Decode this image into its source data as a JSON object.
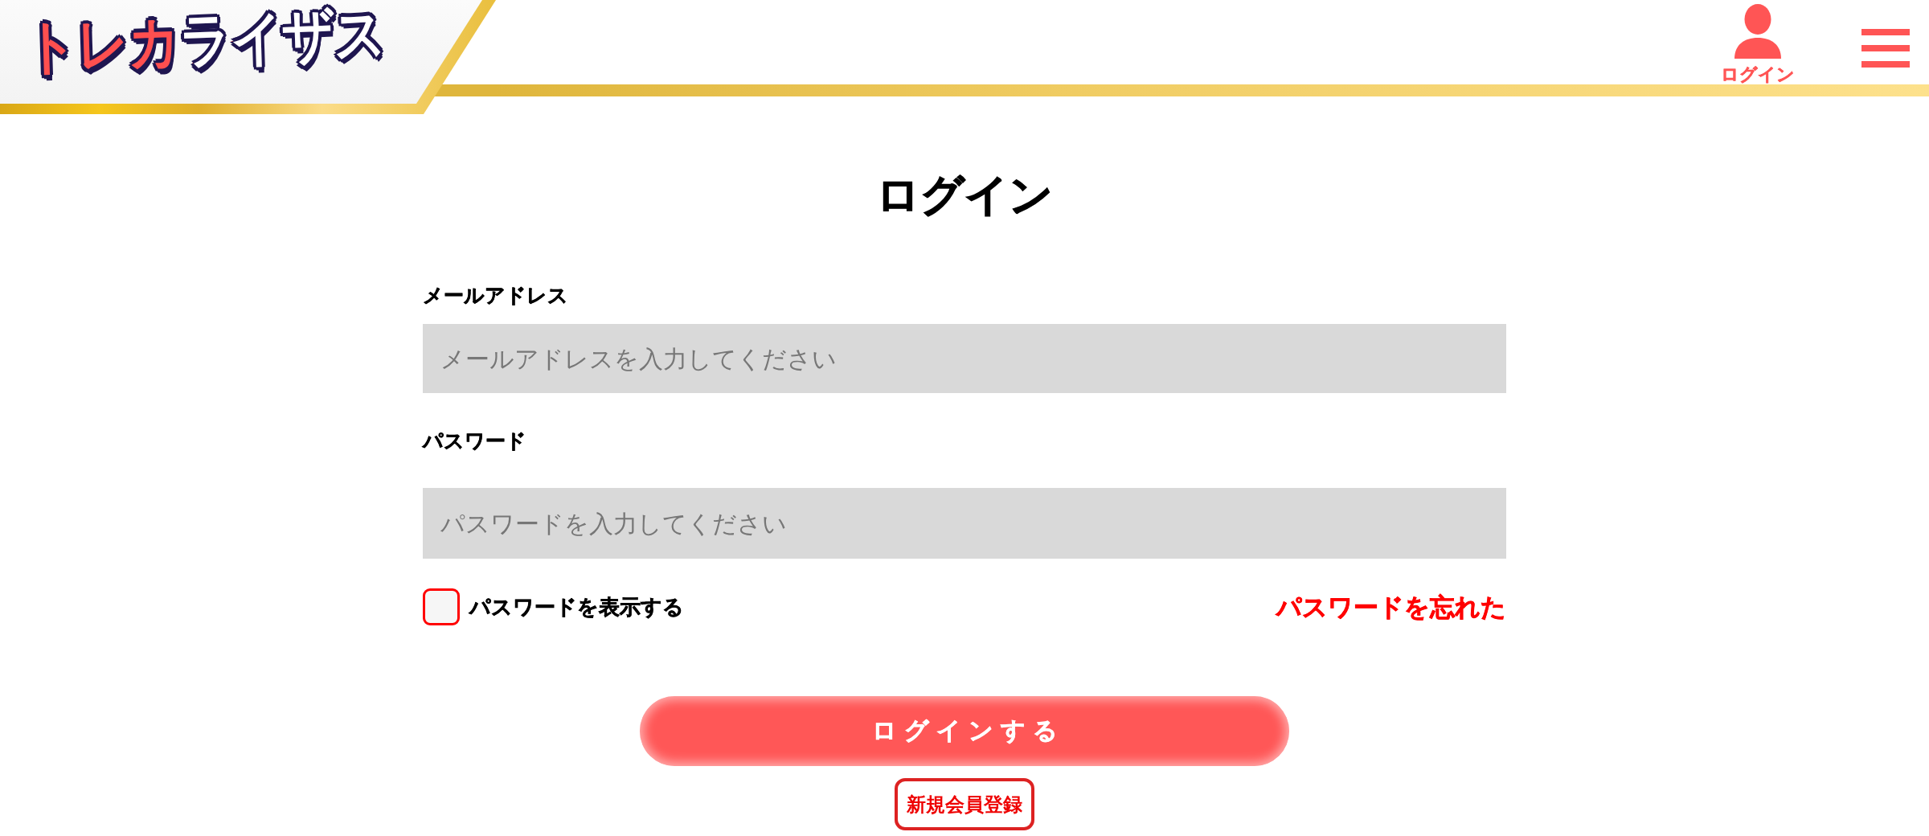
{
  "header": {
    "logo": {
      "parts": [
        "トレカ",
        "ライザス"
      ]
    },
    "login_link": {
      "label": "ログイン"
    }
  },
  "page_title": "ログイン",
  "form": {
    "fields": [
      {
        "label": "メールアドレス",
        "placeholder": "メールアドレスを入力してください"
      },
      {
        "label": "パスワード",
        "placeholder": "パスワードを入力してください"
      }
    ],
    "show_password": {
      "label": "パスワードを表示する",
      "checked": false
    },
    "forgot_password_link": "パスワードを忘れた",
    "submit_button": "ログインする",
    "register_button": "新規会員登録"
  }
}
